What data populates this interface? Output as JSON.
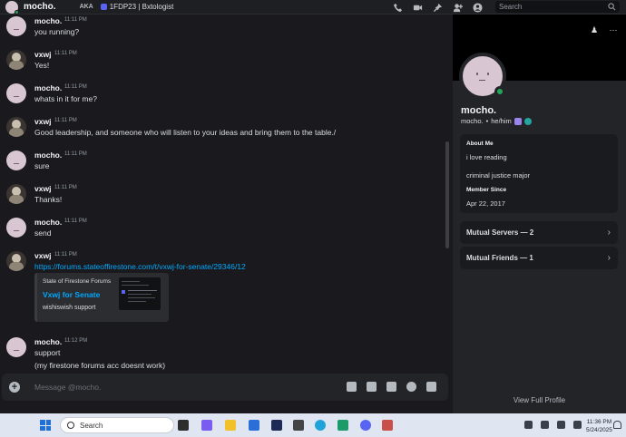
{
  "topbar": {
    "user_name": "mocho.",
    "aka_label": "AKA",
    "tag": "1FDP23 | Bxtologist",
    "search_placeholder": "Search"
  },
  "messages": [
    {
      "author": "mocho.",
      "time": "11:11 PM",
      "lines": [
        "you running?"
      ]
    },
    {
      "author": "vxwj",
      "time": "11:11 PM",
      "lines": [
        "Yes!"
      ]
    },
    {
      "author": "mocho.",
      "time": "11:11 PM",
      "lines": [
        "whats in it for me?"
      ]
    },
    {
      "author": "vxwj",
      "time": "11:11 PM",
      "lines": [
        "Good leadership, and someone who will listen to your ideas and bring them to the table./"
      ]
    },
    {
      "author": "mocho.",
      "time": "11:11 PM",
      "lines": [
        "sure"
      ]
    },
    {
      "author": "vxwj",
      "time": "11:11 PM",
      "lines": [
        "Thanks!"
      ]
    },
    {
      "author": "mocho.",
      "time": "11:11 PM",
      "lines": [
        "send"
      ]
    },
    {
      "author": "vxwj",
      "time": "11:11 PM",
      "lines": [
        "https://forums.stateoffirestone.com/t/vxwj-for-senate/29346/12"
      ],
      "embed": {
        "provider": "State of Firestone Forums",
        "title": "Vxwj for Senate",
        "description": "wishiswish support"
      }
    },
    {
      "author": "mocho.",
      "time": "11:12 PM",
      "lines": [
        "support",
        "(my firestone forums acc doesnt work)"
      ]
    }
  ],
  "composer": {
    "placeholder": "Message @mocho."
  },
  "profile": {
    "display_name": "mocho.",
    "username": "mocho.",
    "separator": "•",
    "pronouns": "he/him",
    "about_label": "About Me",
    "about_lines": [
      "i love reading",
      "criminal justice major"
    ],
    "member_since_label": "Member Since",
    "member_since": "Apr 22, 2017",
    "mutual_servers": "Mutual Servers — 2",
    "mutual_friends": "Mutual Friends — 1",
    "view_full": "View Full Profile"
  },
  "taskbar": {
    "search_label": "Search",
    "time": "11:36 PM",
    "date": "5/24/2025"
  },
  "colors": {
    "accent_link": "#00a8fc",
    "online": "#23a55a",
    "background": "#1a1a1e"
  }
}
